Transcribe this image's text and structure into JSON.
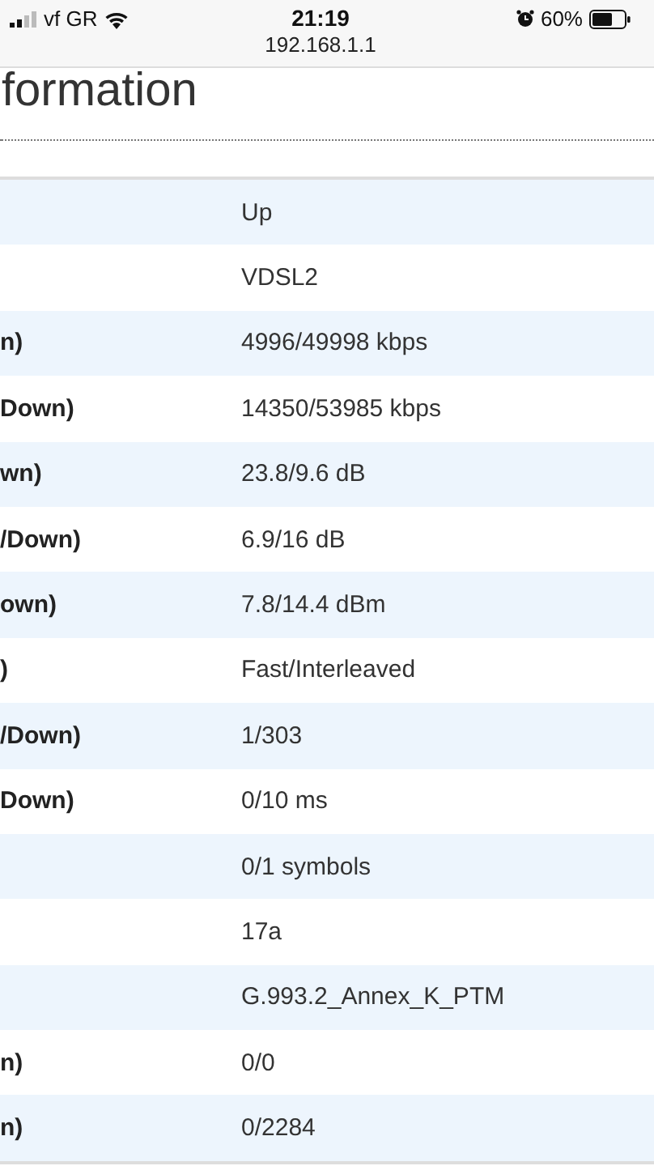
{
  "status_bar": {
    "carrier": "vf GR",
    "time": "21:19",
    "url": "192.168.1.1",
    "battery": "60%"
  },
  "page": {
    "title": "formation"
  },
  "table": {
    "rows": [
      {
        "label": "",
        "value": "Up"
      },
      {
        "label": "",
        "value": "VDSL2"
      },
      {
        "label": "n)",
        "value": "4996/49998 kbps"
      },
      {
        "label": "Down)",
        "value": "14350/53985 kbps"
      },
      {
        "label": "wn)",
        "value": "23.8/9.6 dB"
      },
      {
        "label": "/Down)",
        "value": "6.9/16 dB"
      },
      {
        "label": "own)",
        "value": "7.8/14.4 dBm"
      },
      {
        "label": ")",
        "value": "Fast/Interleaved"
      },
      {
        "label": "/Down)",
        "value": "1/303"
      },
      {
        "label": "Down)",
        "value": "0/10 ms"
      },
      {
        "label": "",
        "value": "0/1 symbols"
      },
      {
        "label": "",
        "value": "17a"
      },
      {
        "label": "",
        "value": "G.993.2_Annex_K_PTM"
      },
      {
        "label": "n)",
        "value": "0/0"
      },
      {
        "label": "n)",
        "value": "0/2284"
      }
    ]
  }
}
